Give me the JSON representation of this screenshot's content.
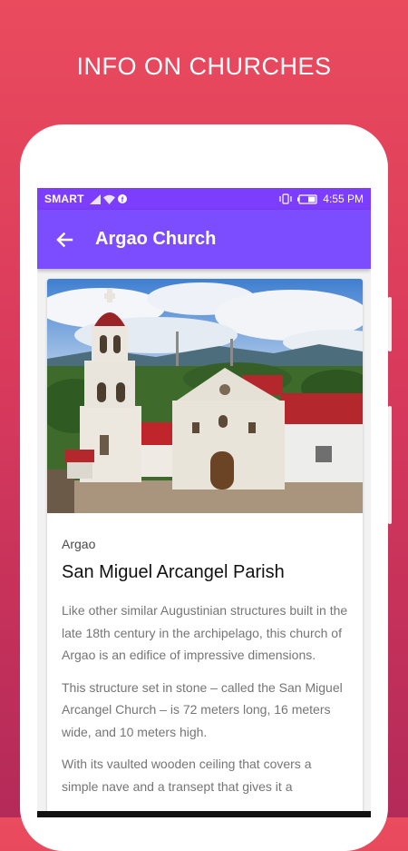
{
  "promo": {
    "title": "INFO ON CHURCHES"
  },
  "status_bar": {
    "carrier": "SMART",
    "time": "4:55 PM"
  },
  "app_bar": {
    "title": "Argao Church"
  },
  "card": {
    "location": "Argao",
    "title": "San Miguel Arcangel Parish",
    "paragraphs": [
      "Like other similar Augustinian structures built in the late 18th century in the archipelago, this church of Argao is an edifice of impressive dimensions.",
      "This structure set in stone – called the San Miguel Arcangel Church – is 72 meters long, 16 meters wide, and 10 meters high.",
      "With its vaulted wooden ceiling that covers a simple nave and a transept that gives it a"
    ]
  },
  "colors": {
    "background_top": "#ea4b5d",
    "background_bottom": "#b42a59",
    "app_bar": "#7c4dff",
    "status_bar": "#7c3dfc"
  },
  "icons": [
    "signal-icon",
    "wifi-icon",
    "facebook-icon",
    "vibrate-icon",
    "battery-icon",
    "back-arrow-icon"
  ]
}
